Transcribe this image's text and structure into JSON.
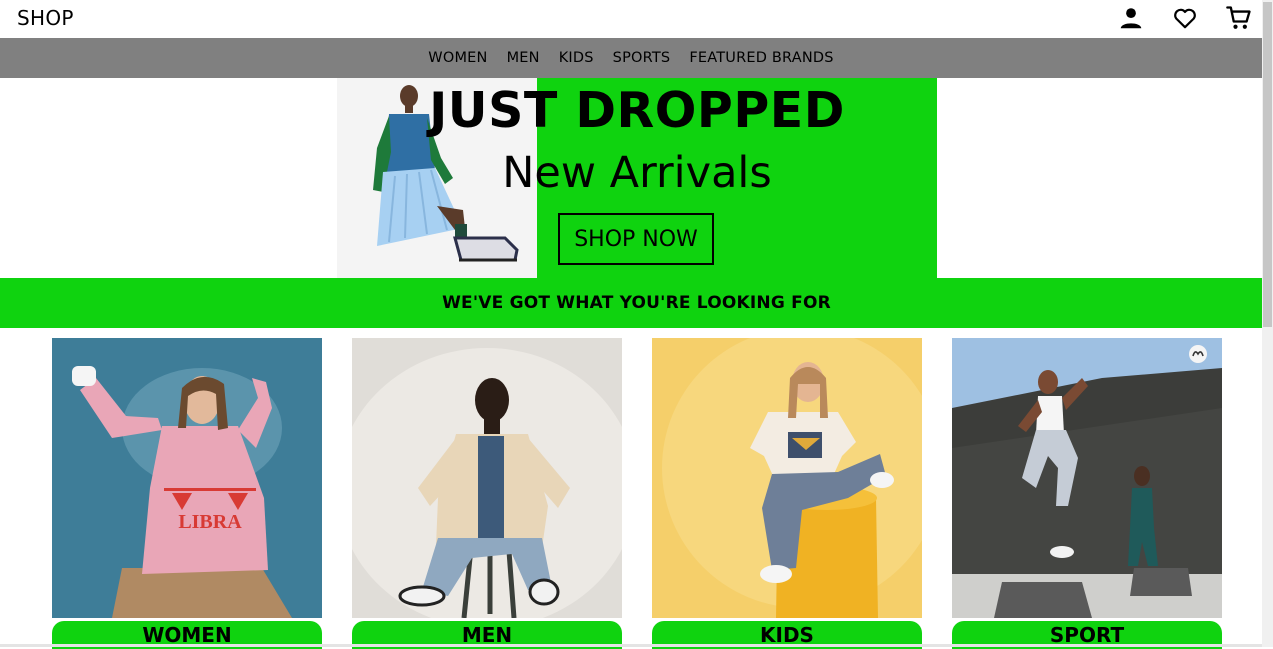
{
  "header": {
    "brand": "SHOP",
    "icons": [
      "user-icon",
      "heart-icon",
      "cart-icon"
    ]
  },
  "nav": {
    "items": [
      "WOMEN",
      "MEN",
      "KIDS",
      "SPORTS",
      "FEATURED BRANDS"
    ]
  },
  "hero": {
    "title": "JUST DROPPED",
    "subtitle": "New Arrivals",
    "button": "SHOP NOW"
  },
  "banner": {
    "text": "WE'VE GOT WHAT YOU'RE LOOKING FOR"
  },
  "categories": [
    {
      "label": "WOMEN"
    },
    {
      "label": "MEN"
    },
    {
      "label": "KIDS"
    },
    {
      "label": "SPORT"
    }
  ],
  "colors": {
    "accent": "#0fd30f",
    "nav_bg": "#808080",
    "text": "#000000"
  }
}
